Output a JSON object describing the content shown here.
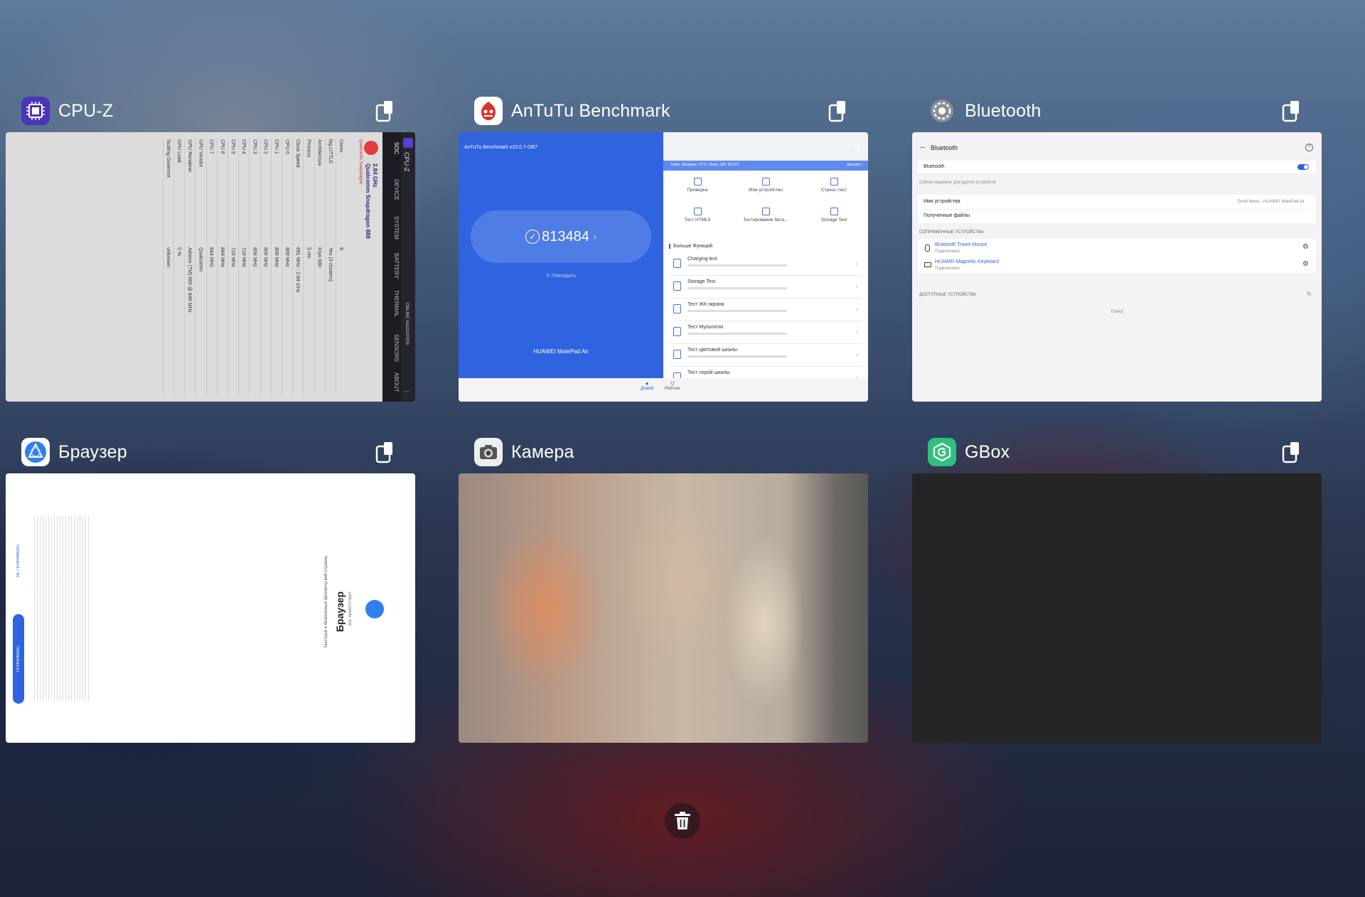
{
  "cards": [
    {
      "name": "CPU-Z",
      "cpuz": {
        "brand": "CPU-Z",
        "tabs": [
          "SOC",
          "DEVICE",
          "SYSTEM",
          "BATTERY",
          "THERMAL",
          "SENSORS",
          "ABOUT"
        ],
        "online_validation": "ONLINE VALIDATION",
        "chip_vendor": "Qualcomm Snapdragon",
        "chip_model": "Qualcomm Snapdragon 888",
        "chip_freq": "2.84 GHz",
        "labels": [
          "Cores",
          "big.LITTLE",
          "Architecture",
          "Process",
          "Clock Speed",
          "CPU 0",
          "CPU 1",
          "CPU 2",
          "CPU 3",
          "CPU 4",
          "CPU 5",
          "CPU 6",
          "CPU 7",
          "GPU Vendor",
          "GPU Renderer",
          "GPU Load",
          "Scaling Governor"
        ],
        "values": [
          "8",
          "Yes (3 clusters)",
          "Kryo 680",
          "5 nm",
          "691 MHz - 2.84 GHz",
          "806 MHz",
          "806 MHz",
          "806 MHz",
          "806 MHz",
          "710 MHz",
          "710 MHz",
          "844 MHz",
          "844 MHz",
          "Qualcomm",
          "Adreno (TM) 660 @ 840 MHz",
          "0 %",
          "unknown"
        ]
      }
    },
    {
      "name": "AnTuTu Benchmark",
      "antutu": {
        "version": "AnTuTu Benchmark v10.0.7-OB7",
        "score": "813484",
        "retest": "Повторить",
        "device": "HUAWEI MatePad Air",
        "top_status": "Темп. батареи: 37°C   Темп. ЦП: 42.5°C",
        "details": "Детали ›",
        "grid": [
          "Проверка",
          "Мое устройство",
          "Стресс-тест",
          "Тест HTML5",
          "Тестирование бата...",
          "Storage Test"
        ],
        "more_label": "Больше Функций",
        "items": [
          "Charging test",
          "Storage Test",
          "Тест ЖК-экрана",
          "Тест Мультитач",
          "Тест цветовой шкалы",
          "Тест серой шкалы"
        ],
        "nav": [
          "Домой",
          "Рейтинг"
        ]
      }
    },
    {
      "name": "Bluetooth",
      "bt": {
        "title": "Bluetooth",
        "toggle_label": "Bluetooth",
        "visible_note": "Сейчас видимое для других устройств",
        "device_name_label": "Имя устройства",
        "device_name_value": "Droid News - HUAWEI MatePad Air",
        "received_files": "Полученные файлы",
        "paired_header": "СОПРЯЖЕННЫЕ УСТРОЙСТВА",
        "paired": [
          {
            "name": "Bluetooth Travel Mouse",
            "status": "Подключено"
          },
          {
            "name": "HUAWEI Magnetic Keyboard",
            "status": "Подключено"
          }
        ],
        "available_header": "ДОСТУПНЫЕ УСТРОЙСТВА",
        "searching": "Поиск"
      }
    },
    {
      "name": "Браузер",
      "browser": {
        "welcome": "Вас приветствует",
        "title": "Браузер",
        "tagline": "Быстрый и безопасный просмотр веб-страниц",
        "accept": "ПРИНИМАЮ",
        "decline": "НЕ ПРИНИМАЮ"
      }
    },
    {
      "name": "Камера"
    },
    {
      "name": "GBox"
    }
  ],
  "colors": {
    "cpuz_icon": "#5b3fd0",
    "antutu_icon": "#e04028",
    "browser_icon": "#2f7ff0",
    "gbox_icon": "#2fc07f",
    "antutu_blue": "#2f63e0"
  }
}
